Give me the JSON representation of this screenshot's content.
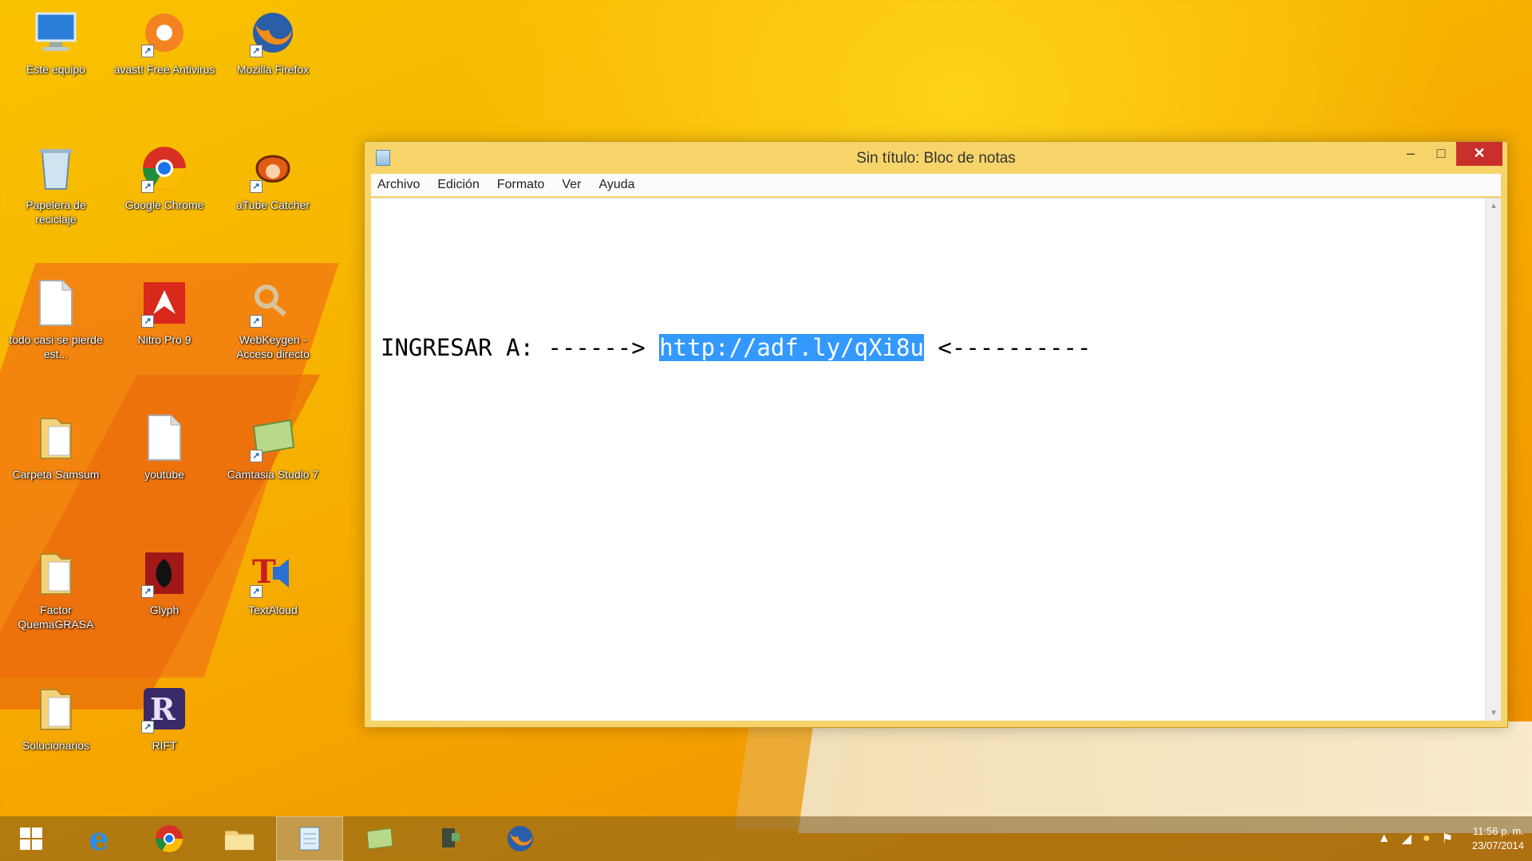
{
  "desktop": {
    "icons": [
      {
        "label": "Este equipo",
        "icon": "computer-icon"
      },
      {
        "label": "avast! Free Antivirus",
        "icon": "avast-icon"
      },
      {
        "label": "Mozilla Firefox",
        "icon": "firefox-icon"
      },
      {
        "label": "Papelera de reciclaje",
        "icon": "recycle-bin-icon"
      },
      {
        "label": "Google Chrome",
        "icon": "chrome-icon"
      },
      {
        "label": "aTube Catcher",
        "icon": "atube-catcher-icon"
      },
      {
        "label": "todo casi se pierde est...",
        "icon": "document-icon"
      },
      {
        "label": "Nitro Pro 9",
        "icon": "nitro-pro-icon"
      },
      {
        "label": "WebKeygen - Acceso directo",
        "icon": "keygen-icon"
      },
      {
        "label": "Carpeta Samsum",
        "icon": "folder-icon"
      },
      {
        "label": "youtube",
        "icon": "document-icon"
      },
      {
        "label": "Camtasia Studio 7",
        "icon": "camtasia-icon"
      },
      {
        "label": "Factor QuemaGRASA",
        "icon": "folder-icon"
      },
      {
        "label": "Glyph",
        "icon": "glyph-icon"
      },
      {
        "label": "TextAloud",
        "icon": "textaloud-icon"
      },
      {
        "label": "Solucionarios",
        "icon": "folder-icon"
      },
      {
        "label": "RIFT",
        "icon": "rift-icon"
      }
    ]
  },
  "notepad": {
    "title": "Sin título: Bloc de notas",
    "menu": [
      "Archivo",
      "Edición",
      "Formato",
      "Ver",
      "Ayuda"
    ],
    "text_before": "INGRESAR A: ------> ",
    "text_selected": "http://adf.ly/qXi8u",
    "text_after": " <----------",
    "controls": {
      "minimize": "–",
      "maximize": "□",
      "close": "✕"
    }
  },
  "taskbar": {
    "buttons": [
      {
        "name": "start-button",
        "glyph": "⊞"
      },
      {
        "name": "internet-explorer",
        "glyph": "e"
      },
      {
        "name": "google-chrome",
        "glyph": "◉"
      },
      {
        "name": "file-explorer",
        "glyph": "▭"
      },
      {
        "name": "notepad",
        "glyph": "▤",
        "active": true
      },
      {
        "name": "camtasia",
        "glyph": "▱"
      },
      {
        "name": "camtasia-recorder",
        "glyph": "▮"
      },
      {
        "name": "firefox",
        "glyph": "◍"
      }
    ],
    "clock_time": "11:56 p. m.",
    "clock_date": "23/07/2014"
  },
  "colors": {
    "selection": "#3399ff",
    "close_button": "#c9302c",
    "window_frame": "#f6d46a"
  }
}
